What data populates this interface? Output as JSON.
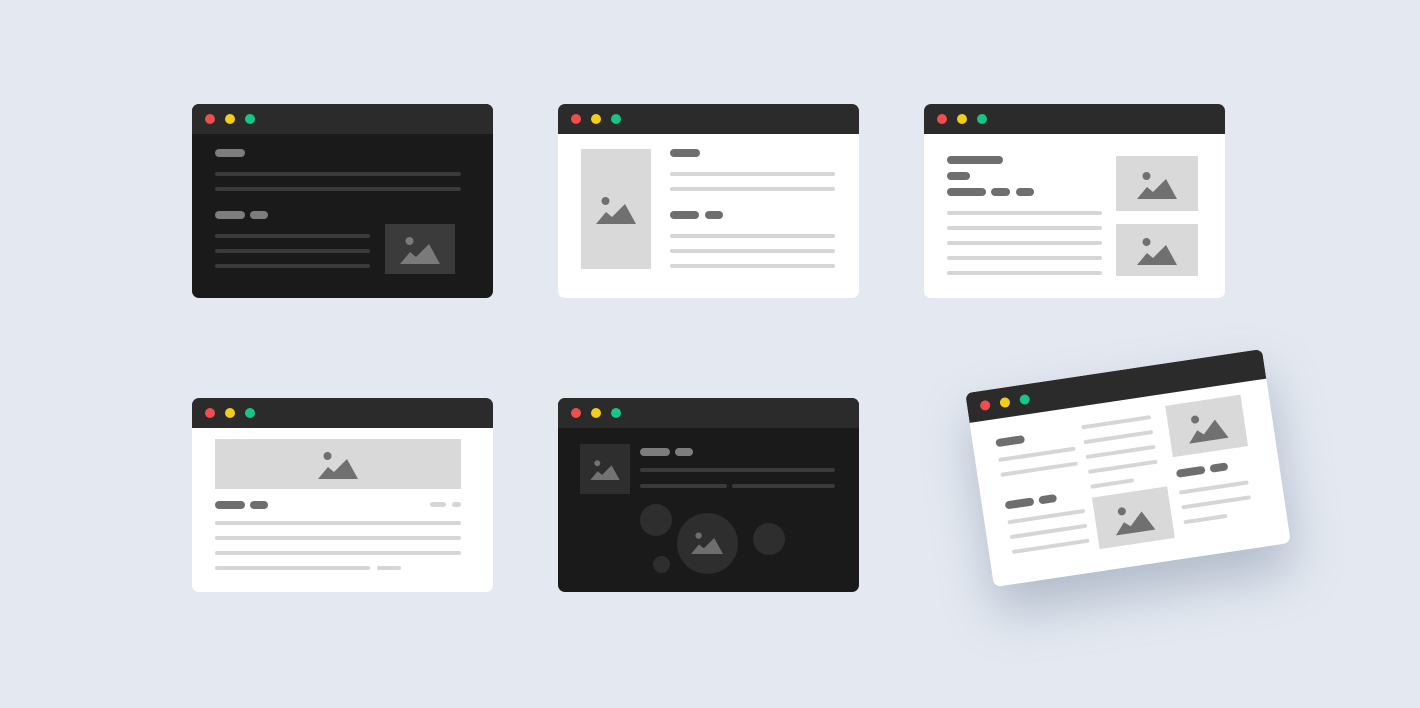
{
  "background_color": "#e4e9f1",
  "window_controls": {
    "close_color": "#f04d4d",
    "minimize_color": "#f4cc1a",
    "maximize_color": "#16c686",
    "titlebar_color": "#2b2b2b"
  },
  "placeholder_icon": "image-icon",
  "windows": [
    {
      "id": "window-1",
      "theme": "dark",
      "layout": "text-with-image-right"
    },
    {
      "id": "window-2",
      "theme": "light",
      "layout": "image-left-text-right"
    },
    {
      "id": "window-3",
      "theme": "light",
      "layout": "text-left-two-images-right"
    },
    {
      "id": "window-4",
      "theme": "light",
      "layout": "banner-image-top-text-below"
    },
    {
      "id": "window-5",
      "theme": "dark",
      "layout": "thumbnail-text-with-circles"
    },
    {
      "id": "window-6",
      "theme": "light",
      "layout": "three-column-tilted"
    }
  ]
}
